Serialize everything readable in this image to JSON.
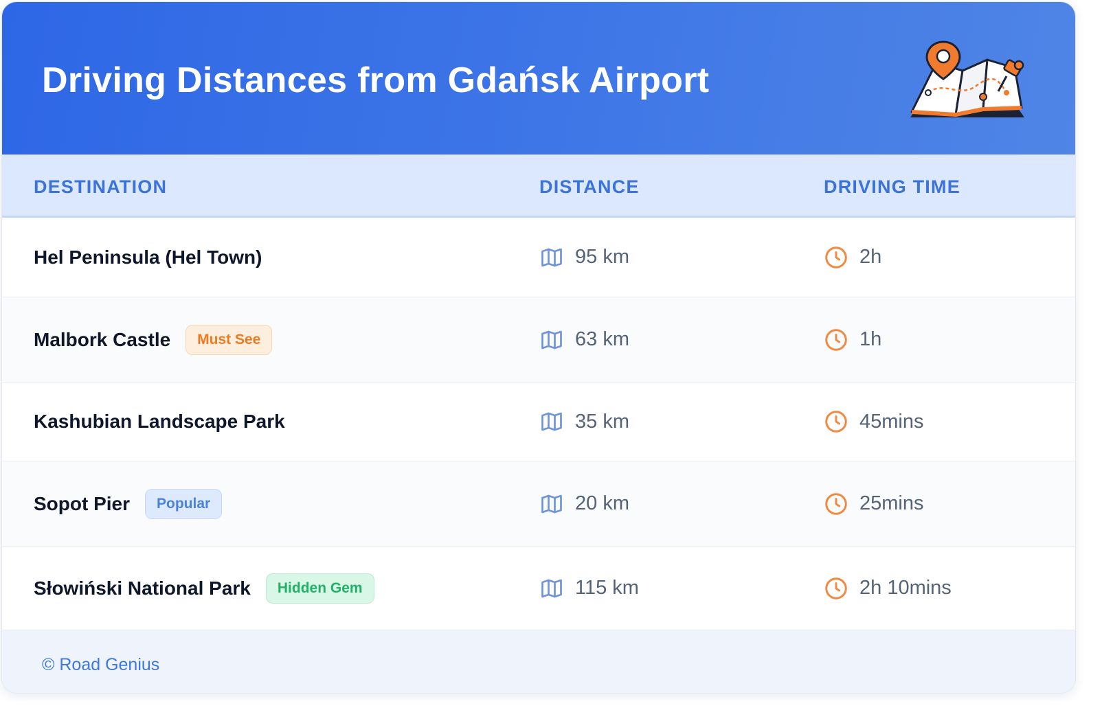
{
  "header": {
    "title": "Driving Distances from Gdańsk Airport",
    "illustration_icon": "map-with-pin-icon"
  },
  "table": {
    "columns": [
      "DESTINATION",
      "DISTANCE",
      "DRIVING TIME"
    ],
    "rows": [
      {
        "destination": "Hel Peninsula (Hel Town)",
        "badge": "",
        "badge_color": "",
        "distance": "95 km",
        "time": "2h"
      },
      {
        "destination": "Malbork Castle",
        "badge": "Must See",
        "badge_color": "orange",
        "distance": "63 km",
        "time": "1h"
      },
      {
        "destination": "Kashubian Landscape Park",
        "badge": "",
        "badge_color": "",
        "distance": "35 km",
        "time": "45mins"
      },
      {
        "destination": "Sopot Pier",
        "badge": "Popular",
        "badge_color": "blue",
        "distance": "20 km",
        "time": "25mins"
      },
      {
        "destination": "Słowiński National Park",
        "badge": "Hidden Gem",
        "badge_color": "green",
        "distance": "115 km",
        "time": "2h 10mins"
      }
    ]
  },
  "icons": {
    "distance": "map-icon",
    "time": "clock-icon"
  },
  "footer": {
    "text": "© Road Genius"
  },
  "colors": {
    "header_gradient_start": "#2e67e6",
    "header_gradient_end": "#4f85e6",
    "column_header_text": "#3b73db",
    "map_icon": "#6f94dc",
    "clock_icon": "#f08a43",
    "footer_text": "#3f78dc"
  }
}
